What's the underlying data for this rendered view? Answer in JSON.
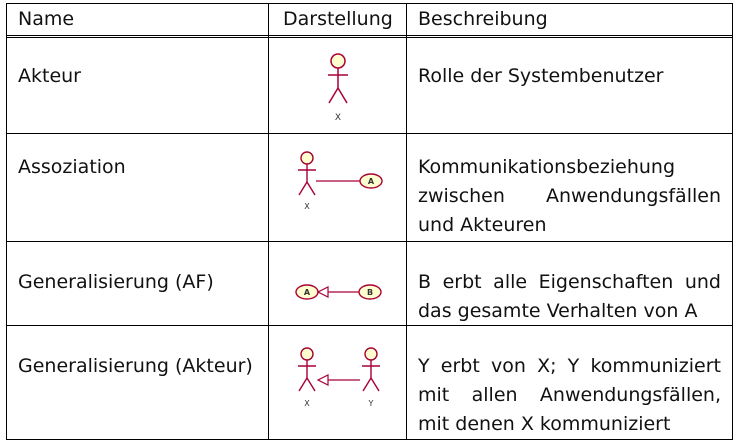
{
  "table": {
    "headers": {
      "name": "Name",
      "depiction": "Darstellung",
      "description": "Beschreibung"
    },
    "rows": [
      {
        "name": "Akteur",
        "description_lines": [
          "Rolle der Systembenutzer"
        ],
        "icon": "uml-actor-icon",
        "labels": {
          "actor": "X"
        }
      },
      {
        "name": "Assoziation",
        "description_lines": [
          "Kommunikationsbeziehung",
          "zwischen Anwendungsfällen",
          "und Akteuren"
        ],
        "icon": "uml-association-icon",
        "labels": {
          "actor": "X",
          "usecase": "A"
        }
      },
      {
        "name": "Generalisierung (AF)",
        "description_lines": [
          "B erbt alle Eigenschaften und",
          "das gesamte Verhalten von A"
        ],
        "icon": "uml-usecase-generalization-icon",
        "labels": {
          "usecase_parent": "A",
          "usecase_child": "B"
        }
      },
      {
        "name": "Generalisierung (Akteur)",
        "description_lines": [
          "Y erbt von X; Y kommuniziert",
          "mit allen Anwendungsfällen,",
          "mit denen X kommuniziert"
        ],
        "icon": "uml-actor-generalization-icon",
        "labels": {
          "actor_parent": "X",
          "actor_child": "Y"
        }
      }
    ]
  },
  "colors": {
    "uml_fill": "#fefece",
    "uml_stroke": "#a80036",
    "grid": "#000000"
  }
}
